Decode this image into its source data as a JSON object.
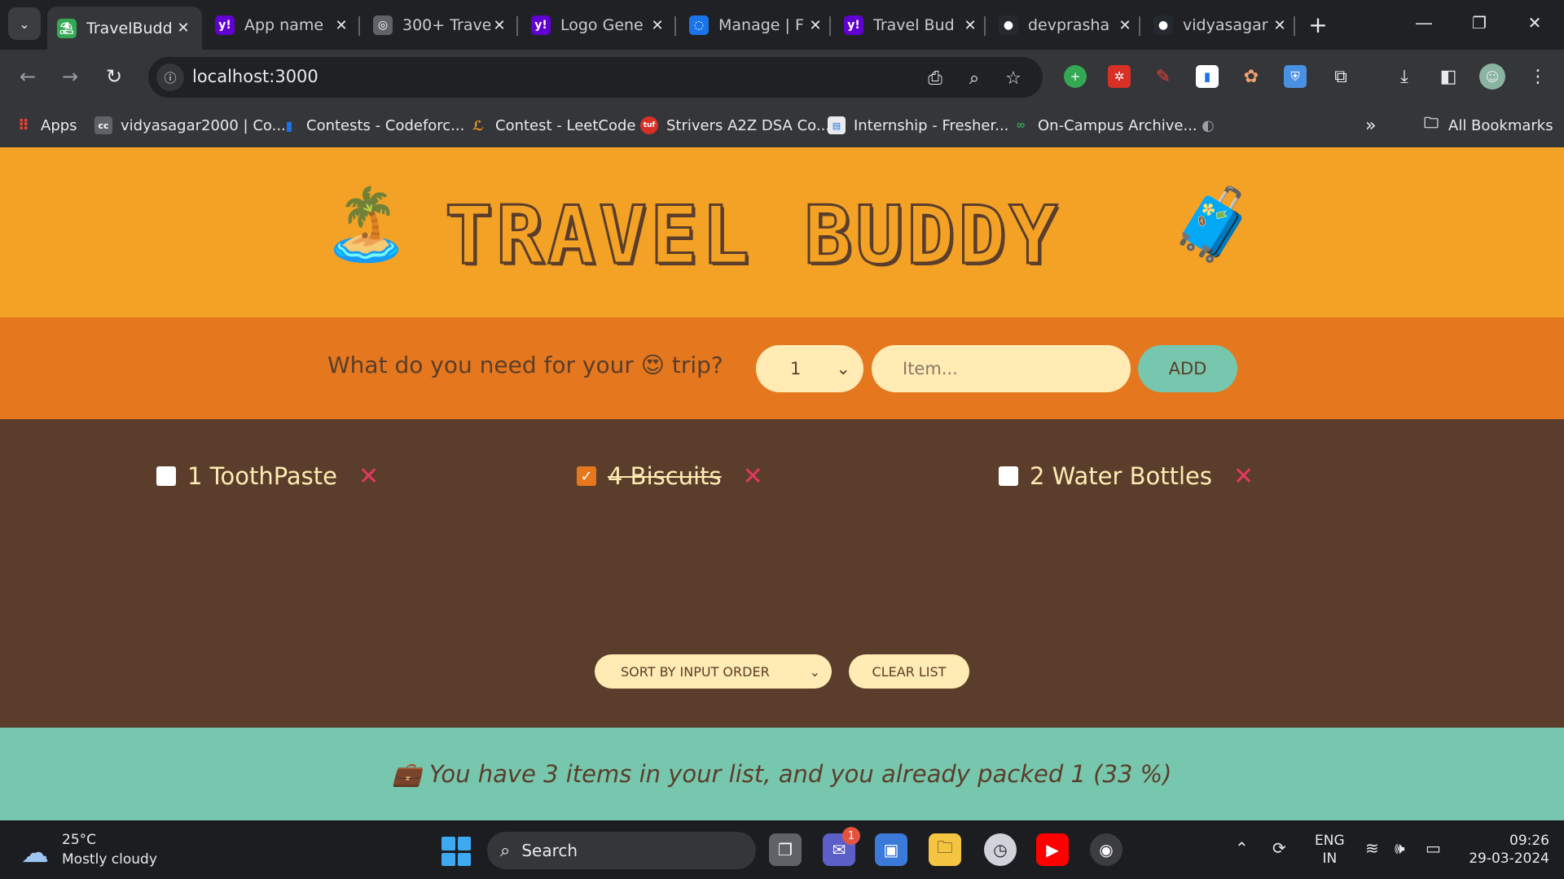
{
  "browser": {
    "tabs": [
      {
        "title": "TravelBudd",
        "favicon_color": "#34a853",
        "favicon_glyph": "⛱",
        "active": true
      },
      {
        "title": "App name",
        "favicon_color": "#6001d2",
        "favicon_glyph": "y!"
      },
      {
        "title": "300+ Trave",
        "favicon_color": "#5f6368",
        "favicon_glyph": "◎"
      },
      {
        "title": "Logo Gene",
        "favicon_color": "#6001d2",
        "favicon_glyph": "y!"
      },
      {
        "title": "Manage | F",
        "favicon_color": "#1a73e8",
        "favicon_glyph": "◌"
      },
      {
        "title": "Travel Bud",
        "favicon_color": "#6001d2",
        "favicon_glyph": "y!"
      },
      {
        "title": "devprasha",
        "favicon_color": "#24292f",
        "favicon_glyph": "●"
      },
      {
        "title": "vidyasagar",
        "favicon_color": "#24292f",
        "favicon_glyph": "●"
      }
    ],
    "url": "localhost:3000",
    "bookmarks": [
      {
        "label": "Apps",
        "icon_color": "#ea4335"
      },
      {
        "label": "vidyasagar2000 | Co...",
        "icon_color": "#5f6368"
      },
      {
        "label": "Contests - Codeforc...",
        "icon_color": "#1a73e8"
      },
      {
        "label": "Contest - LeetCode",
        "icon_color": "#f89f1b"
      },
      {
        "label": "Strivers A2Z DSA Co...",
        "icon_color": "#d93025"
      },
      {
        "label": "Internship - Fresher...",
        "icon_color": "#1a73e8"
      },
      {
        "label": "On-Campus Archive...",
        "icon_color": "#34a853"
      }
    ],
    "all_bookmarks_label": "All Bookmarks"
  },
  "app": {
    "title": "TRAVEL BUDDY",
    "form": {
      "label_before": "What do you need for your",
      "label_emoji": "😍",
      "label_after": "trip?",
      "quantity_value": "1",
      "item_placeholder": "Item...",
      "add_label": "ADD"
    },
    "items": [
      {
        "quantity": 1,
        "description": "ToothPaste",
        "packed": false
      },
      {
        "quantity": 4,
        "description": "Biscuits",
        "packed": true
      },
      {
        "quantity": 2,
        "description": "Water Bottles",
        "packed": false
      }
    ],
    "sort_value": "SORT BY INPUT ORDER",
    "clear_label": "CLEAR LIST",
    "stats_text": "💼 You have 3 items in your list, and you already packed 1 (33 %)",
    "colors": {
      "header": "#f4a226",
      "form_bar": "#e5771e",
      "list_bg": "#5a3e2b",
      "stats_bar": "#76c7ad",
      "cream": "#ffebb3",
      "delete": "#e5385e"
    }
  },
  "taskbar": {
    "weather_temp": "25°C",
    "weather_desc": "Mostly cloudy",
    "search_label": "Search",
    "chat_badge": "1",
    "lang_top": "ENG",
    "lang_bottom": "IN",
    "time": "09:26",
    "date": "29-03-2024"
  }
}
